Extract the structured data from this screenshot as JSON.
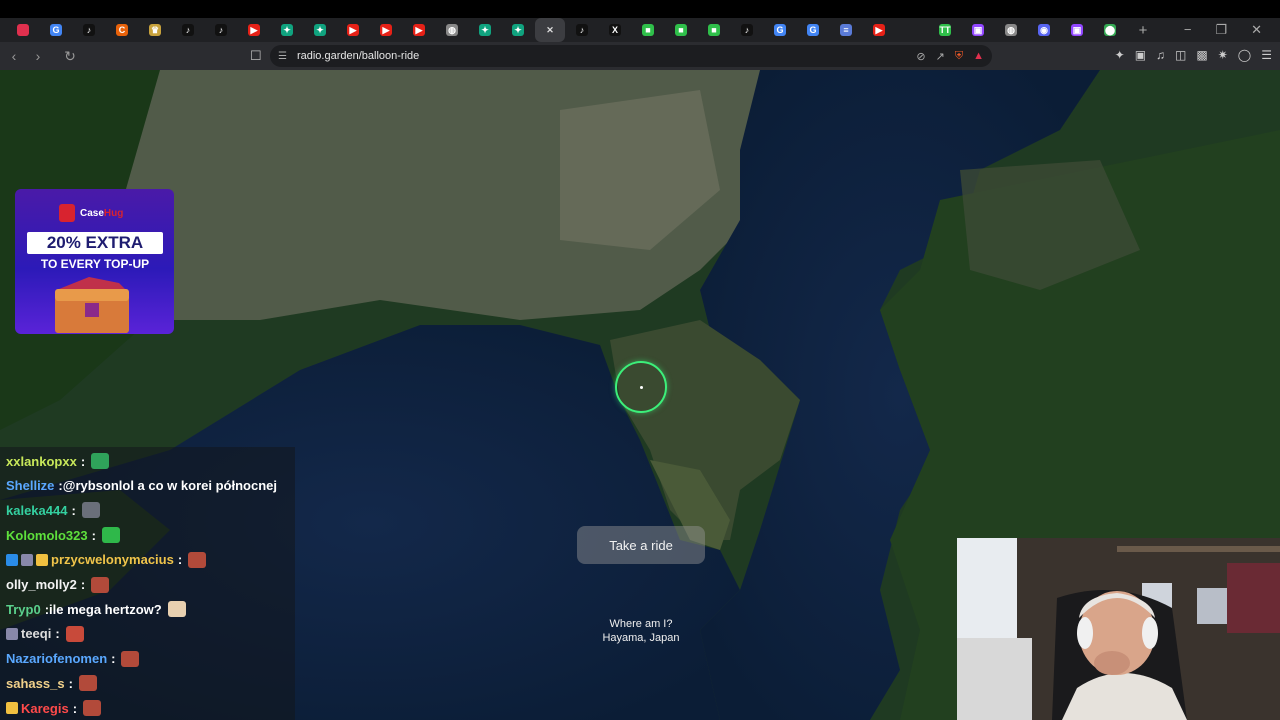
{
  "browser": {
    "url": "radio.garden/balloon-ride",
    "tabs": [
      {
        "icon": "brave-icon",
        "color": "#e0304e",
        "glyph": ""
      },
      {
        "icon": "google-icon",
        "color": "#4285f4",
        "glyph": "G"
      },
      {
        "icon": "tiktok-icon",
        "color": "#111111",
        "glyph": "♪"
      },
      {
        "icon": "c-icon",
        "color": "#e8620a",
        "glyph": "C"
      },
      {
        "icon": "crown-icon",
        "color": "#c8a23c",
        "glyph": "♛"
      },
      {
        "icon": "tiktok-icon",
        "color": "#111111",
        "glyph": "♪"
      },
      {
        "icon": "tiktok-icon",
        "color": "#111111",
        "glyph": "♪"
      },
      {
        "icon": "youtube-icon",
        "color": "#e62117",
        "glyph": "▶"
      },
      {
        "icon": "chatgpt-icon",
        "color": "#10a37f",
        "glyph": "✦"
      },
      {
        "icon": "chatgpt-icon",
        "color": "#10a37f",
        "glyph": "✦"
      },
      {
        "icon": "youtube-icon",
        "color": "#e62117",
        "glyph": "▶"
      },
      {
        "icon": "youtube-icon",
        "color": "#e62117",
        "glyph": "▶"
      },
      {
        "icon": "youtube-icon",
        "color": "#e62117",
        "glyph": "▶"
      },
      {
        "icon": "globe-icon",
        "color": "#888888",
        "glyph": "◍"
      },
      {
        "icon": "chatgpt-icon",
        "color": "#10a37f",
        "glyph": "✦"
      },
      {
        "icon": "chatgpt-icon",
        "color": "#10a37f",
        "glyph": "✦"
      },
      {
        "icon": "close-icon",
        "color": "#3c3d41",
        "glyph": "✕",
        "active": true
      },
      {
        "icon": "tiktok-icon",
        "color": "#111111",
        "glyph": "♪"
      },
      {
        "icon": "x-icon",
        "color": "#111111",
        "glyph": "X"
      },
      {
        "icon": "green-square-icon",
        "color": "#2fbf4a",
        "glyph": "■"
      },
      {
        "icon": "green-square-icon",
        "color": "#2fbf4a",
        "glyph": "■"
      },
      {
        "icon": "green-square-icon",
        "color": "#2fbf4a",
        "glyph": "■"
      },
      {
        "icon": "tiktok-icon",
        "color": "#111111",
        "glyph": "♪"
      },
      {
        "icon": "google-icon",
        "color": "#4285f4",
        "glyph": "G"
      },
      {
        "icon": "google-icon",
        "color": "#4285f4",
        "glyph": "G"
      },
      {
        "icon": "docs-icon",
        "color": "#5a7bd8",
        "glyph": "≡"
      },
      {
        "icon": "youtube-icon",
        "color": "#e62117",
        "glyph": "▶"
      },
      {
        "icon": "blank-icon",
        "color": "#202124",
        "glyph": ""
      },
      {
        "icon": "tt-icon",
        "color": "#2fbf4a",
        "glyph": "TT"
      },
      {
        "icon": "twitch-icon",
        "color": "#9146ff",
        "glyph": "▣"
      },
      {
        "icon": "globe-icon",
        "color": "#888888",
        "glyph": "◍"
      },
      {
        "icon": "discord-icon",
        "color": "#5865f2",
        "glyph": "◉"
      },
      {
        "icon": "twitch-icon",
        "color": "#9146ff",
        "glyph": "▣"
      },
      {
        "icon": "maps-pin-icon",
        "color": "#34a853",
        "glyph": "⬤"
      }
    ],
    "new_tab": "+",
    "window_controls": [
      "−",
      "❐",
      "✕"
    ]
  },
  "map": {
    "location_label": "Where am I?",
    "location_name": "Hayama, Japan",
    "ride_button": "Take a ride",
    "marker_color": "#3cf07a"
  },
  "ad": {
    "brand_case": "Case",
    "brand_hug": "Hug",
    "headline": "20% EXTRA",
    "subline": "TO EVERY TOP-UP"
  },
  "chat": {
    "messages": [
      {
        "user": "xxlankopxx",
        "color": "#c8e85a",
        "text": "",
        "emote": "#2fa35a"
      },
      {
        "user": "Shellize",
        "color": "#5aa8ff",
        "text": "@rybsonlol a co w korei północnej",
        "emote": ""
      },
      {
        "user": "kaleka444",
        "color": "#34d0a0",
        "text": "",
        "emote": "#6a6f7a"
      },
      {
        "user": "Kolomolo323",
        "color": "#5ee03c",
        "text": "",
        "emote": "#2fb84a"
      },
      {
        "user": "przycwelonymacius",
        "color": "#f0c44a",
        "text": "",
        "emote": "#b24a3a",
        "badges": [
          "#2a8ce8",
          "#8888aa",
          "#f0c040"
        ]
      },
      {
        "user": "olly_molly2",
        "color": "#f4f4f4",
        "text": "",
        "emote": "#b24a3a"
      },
      {
        "user": "Tryp0",
        "color": "#5ad08c",
        "text": "ile mega hertzow?",
        "emote": "#e8d0b0"
      },
      {
        "user": "teeqi",
        "color": "#dddddd",
        "text": "",
        "emote": "#c84a3a",
        "badges": [
          "#8888aa"
        ]
      },
      {
        "user": "Nazariofenomen",
        "color": "#5aa8ff",
        "text": "",
        "emote": "#b24a3a"
      },
      {
        "user": "sahass_s",
        "color": "#f0d08a",
        "text": "",
        "emote": "#b24a3a"
      },
      {
        "user": "Karegis",
        "color": "#ff4a4a",
        "text": "",
        "emote": "#b24a3a",
        "badges": [
          "#f0c040"
        ]
      }
    ]
  }
}
